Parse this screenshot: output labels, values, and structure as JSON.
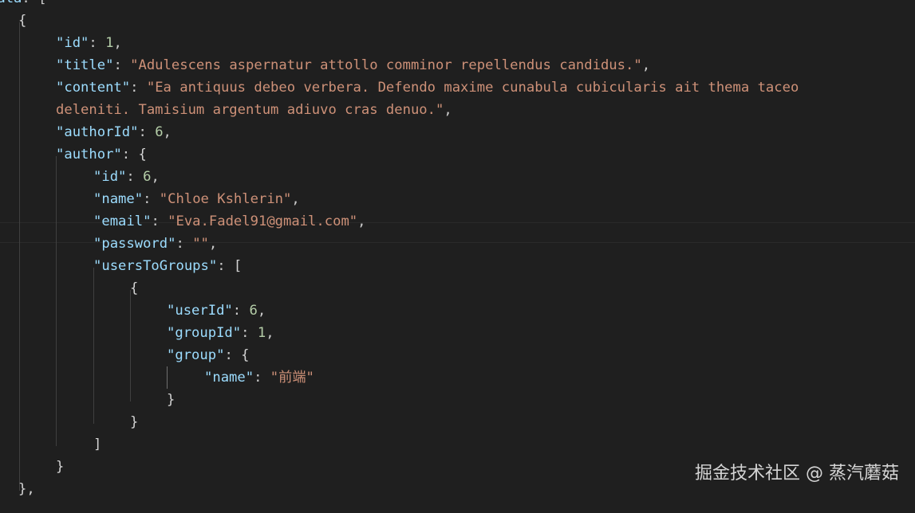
{
  "code": {
    "l0": {
      "key": "data",
      "punct": ": ["
    },
    "l1": {
      "punct": "{"
    },
    "l2": {
      "key": "\"id\"",
      "colon": ": ",
      "value": "1",
      "comma": ","
    },
    "l3": {
      "key": "\"title\"",
      "colon": ": ",
      "value": "\"Adulescens aspernatur attollo comminor repellendus candidus.\"",
      "comma": ","
    },
    "l4": {
      "key": "\"content\"",
      "colon": ": ",
      "value": "\"Ea antiquus debeo verbera. Defendo maxime cunabula cubicularis ait thema taceo"
    },
    "l5": {
      "value": "deleniti. Tamisium argentum adiuvo cras denuo.\"",
      "comma": ","
    },
    "l6": {
      "key": "\"authorId\"",
      "colon": ": ",
      "value": "6",
      "comma": ","
    },
    "l7": {
      "key": "\"author\"",
      "colon": ": ",
      "punct": "{"
    },
    "l8": {
      "key": "\"id\"",
      "colon": ": ",
      "value": "6",
      "comma": ","
    },
    "l9": {
      "key": "\"name\"",
      "colon": ": ",
      "value": "\"Chloe Kshlerin\"",
      "comma": ","
    },
    "l10": {
      "key": "\"email\"",
      "colon": ": ",
      "value": "\"Eva.Fadel91@gmail.com\"",
      "comma": ","
    },
    "l11": {
      "key": "\"password\"",
      "colon": ": ",
      "value": "\"\"",
      "comma": ","
    },
    "l12": {
      "key": "\"usersToGroups\"",
      "colon": ": ",
      "punct": "["
    },
    "l13": {
      "punct": "{"
    },
    "l14": {
      "key": "\"userId\"",
      "colon": ": ",
      "value": "6",
      "comma": ","
    },
    "l15": {
      "key": "\"groupId\"",
      "colon": ": ",
      "value": "1",
      "comma": ","
    },
    "l16": {
      "key": "\"group\"",
      "colon": ": ",
      "punct": "{"
    },
    "l17": {
      "key": "\"name\"",
      "colon": ": ",
      "value": "\"前端\""
    },
    "l18": {
      "punct": "}"
    },
    "l19": {
      "punct": "}"
    },
    "l20": {
      "punct": "]"
    },
    "l21": {
      "punct": "}"
    },
    "l22": {
      "punct": "},"
    }
  },
  "watermark": "掘金技术社区 @ 蒸汽蘑菇",
  "colors": {
    "background": "#1f1f1f",
    "key": "#9cdcfe",
    "string": "#ce9178",
    "number": "#b5cea8"
  }
}
